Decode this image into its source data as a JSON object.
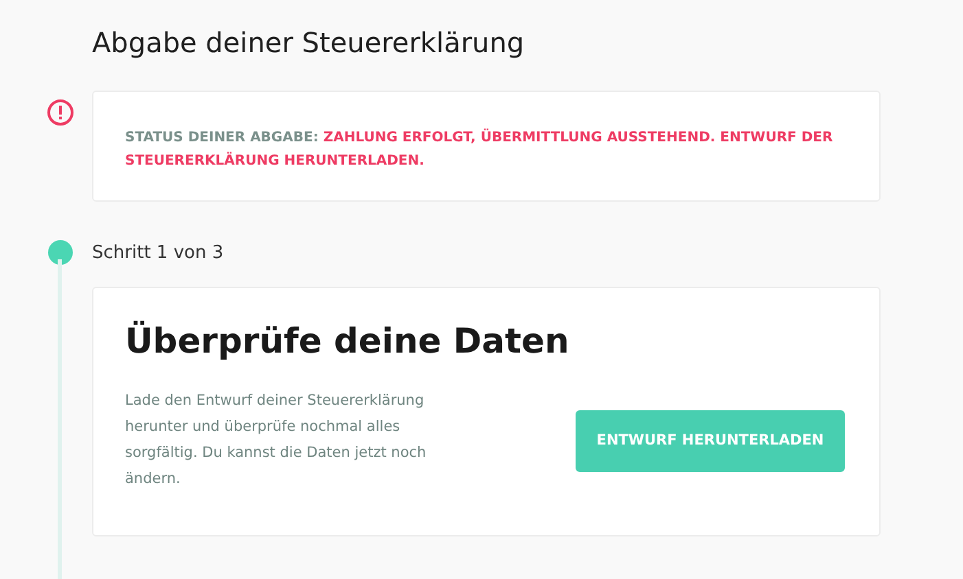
{
  "title": "Abgabe deiner Steuererklärung",
  "status": {
    "label": "STATUS DEINER ABGABE:",
    "message": "ZAHLUNG ERFOLGT, ÜBERMITTLUNG AUSSTEHEND. ENTWURF DER STEUERERKLÄRUNG HERUNTERLADEN."
  },
  "step": {
    "label": "Schritt 1 von 3",
    "heading": "Überprüfe deine Daten",
    "text": "Lade den Entwurf deiner Steuererklärung herunter und überprüfe nochmal alles sorgfältig. Du kannst die Daten jetzt noch ändern.",
    "button": "ENTWURF HERUNTERLADEN"
  }
}
